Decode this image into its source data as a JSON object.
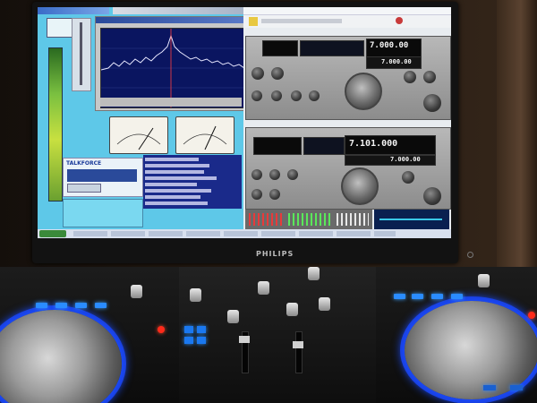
{
  "monitor": {
    "brand": "PHILIPS"
  },
  "left_app": {
    "panel_label": "TALKFORCE"
  },
  "radio_top": {
    "freq_main": "7.000.00",
    "freq_sub": "7.000.00"
  },
  "radio_bottom": {
    "freq_main": "7.101.000",
    "freq_sub": "7.000.00"
  },
  "colors": {
    "led_blue": "#2a8cff",
    "led_red": "#ff2a1a",
    "desktop_cyan": "#5ec8e8"
  }
}
